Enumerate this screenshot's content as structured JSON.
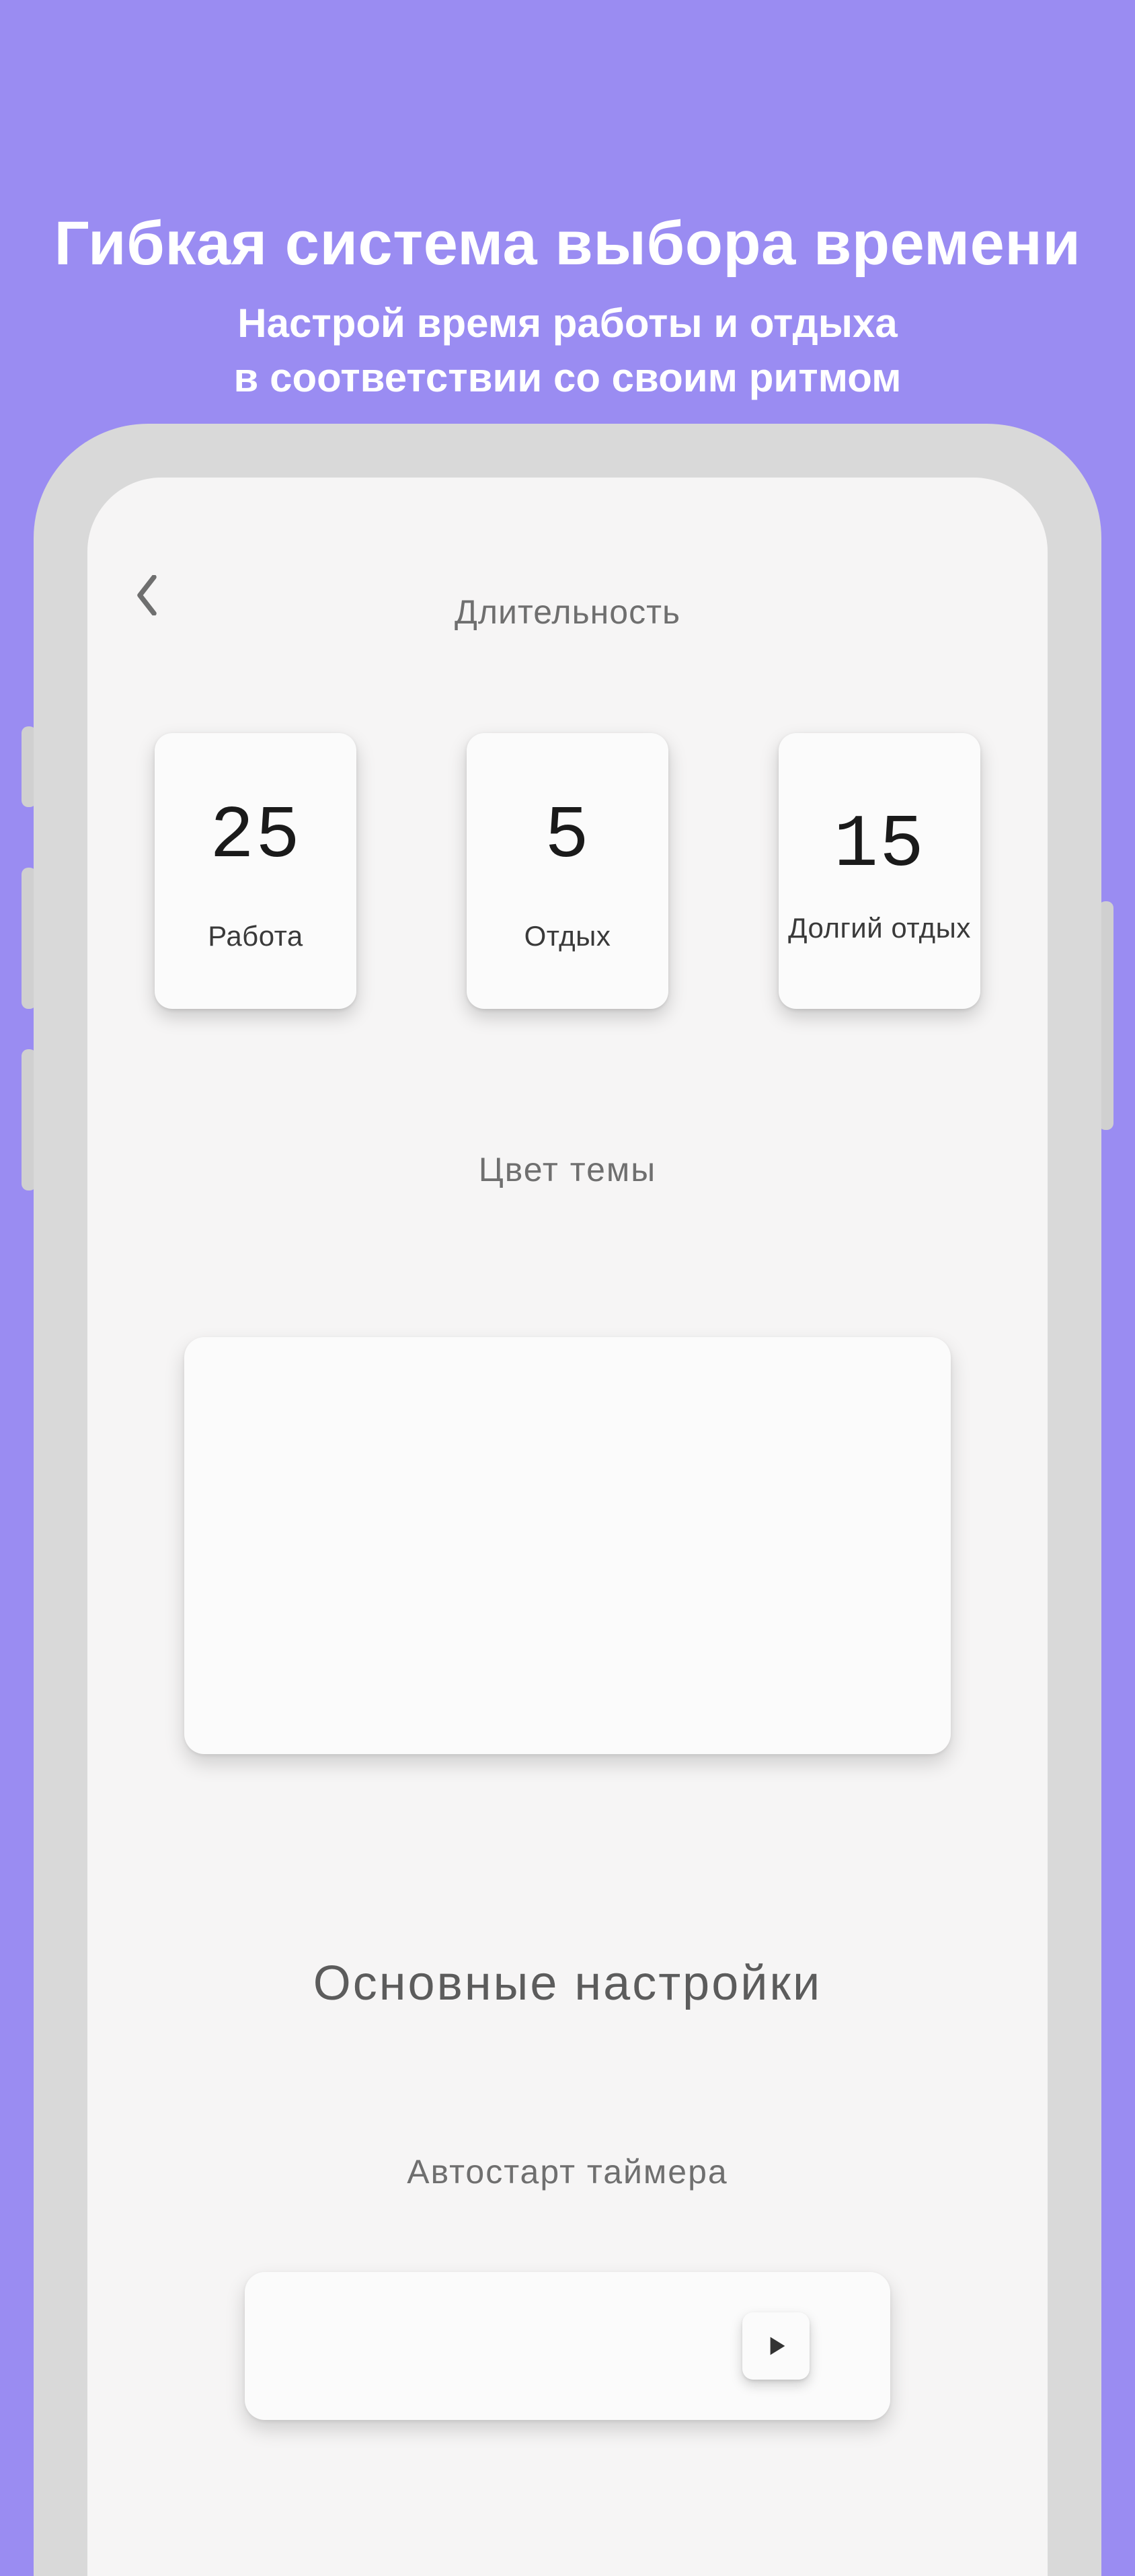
{
  "promo": {
    "title": "Гибкая система выбора времени",
    "subtitle_line1": "Настрой время работы и отдыха",
    "subtitle_line2": "в соответствии со своим ритмом"
  },
  "header": {
    "title": "Длительность"
  },
  "durations": {
    "work": {
      "value": "25",
      "label": "Работа"
    },
    "rest": {
      "value": "5",
      "label": "Отдых"
    },
    "long_rest": {
      "value": "15",
      "label": "Долгий отдых"
    }
  },
  "theme": {
    "label": "Цвет темы"
  },
  "settings": {
    "title": "Основные настройки",
    "autostart_label": "Автостарт таймера"
  }
}
